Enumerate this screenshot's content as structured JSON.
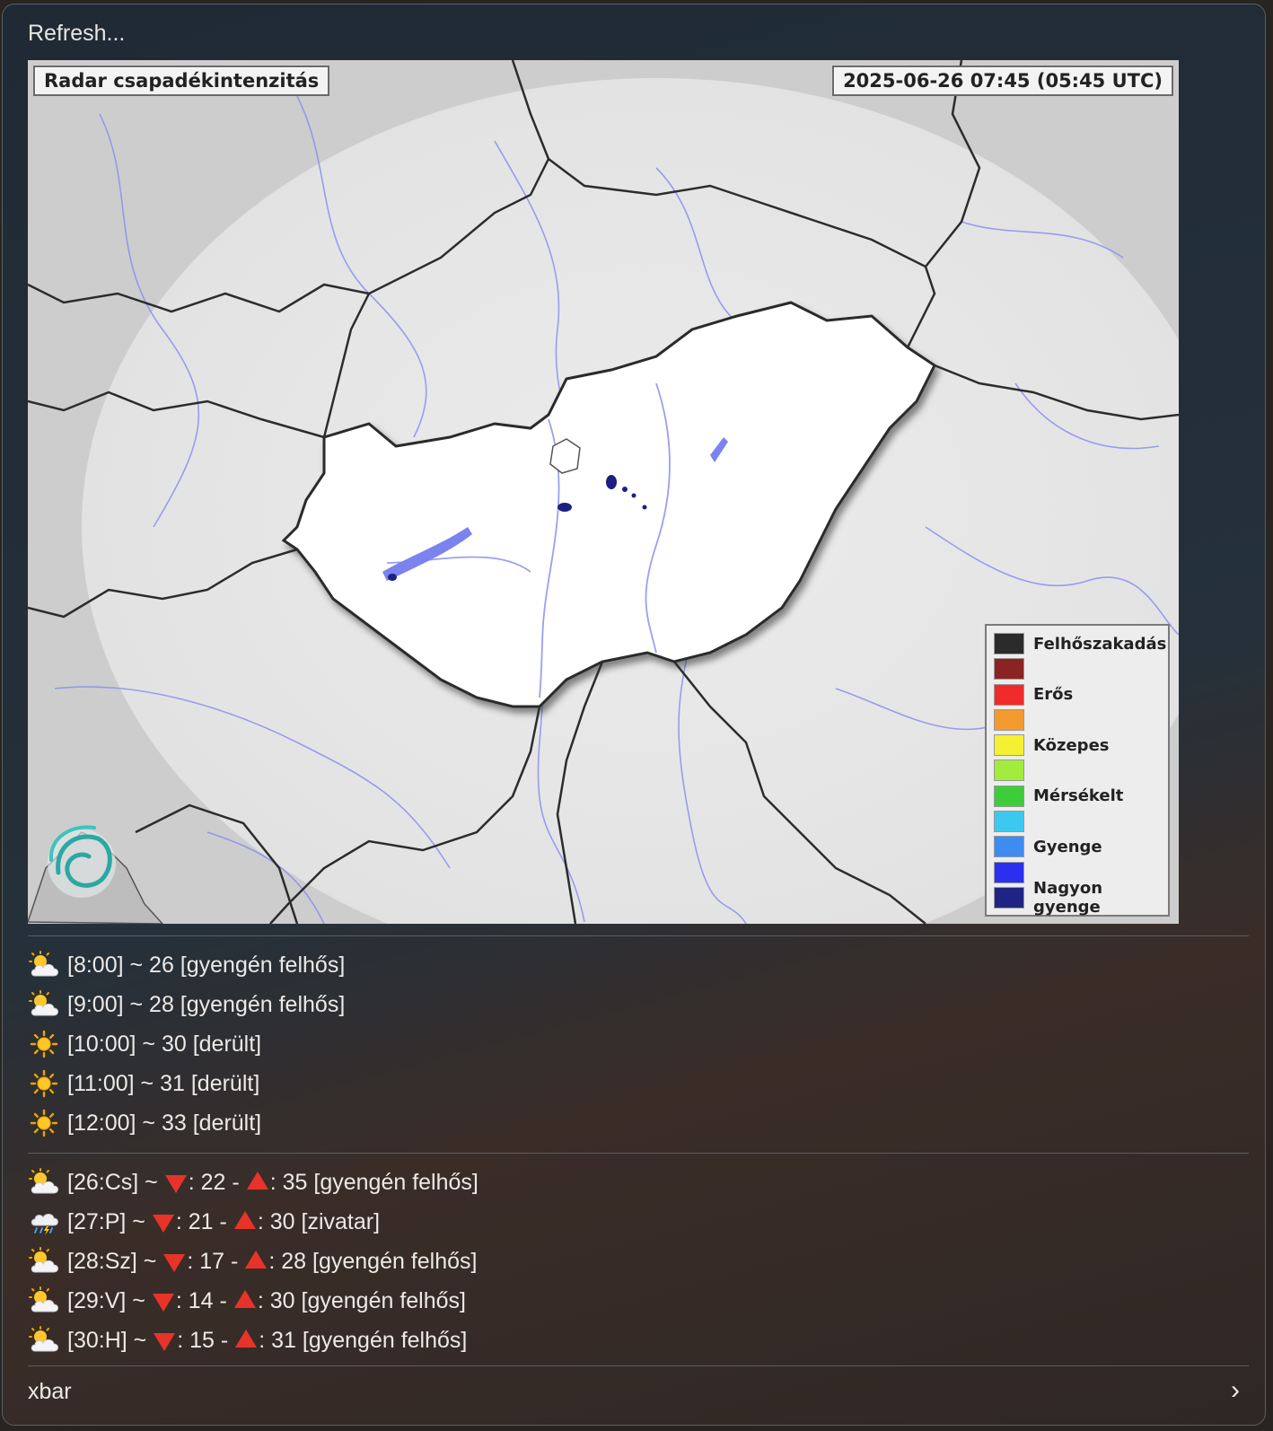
{
  "menu": {
    "refresh_label": "Refresh...",
    "footer_label": "xbar",
    "submenu_arrow": "›"
  },
  "radar": {
    "title": "Radar csapadékintenzitás",
    "timestamp": "2025-06-26 07:45 (05:45 UTC)",
    "legend": [
      {
        "label": "Felhőszakadás",
        "color": "#2b2b2b"
      },
      {
        "label": "",
        "color": "#8c2323"
      },
      {
        "label": "Erős",
        "color": "#f02b2b"
      },
      {
        "label": "",
        "color": "#f39a2f"
      },
      {
        "label": "Közepes",
        "color": "#f5f032"
      },
      {
        "label": "",
        "color": "#a2ec3c"
      },
      {
        "label": "Mérsékelt",
        "color": "#3fcc3a"
      },
      {
        "label": "",
        "color": "#3dc8f0"
      },
      {
        "label": "Gyenge",
        "color": "#3d8cf2"
      },
      {
        "label": "",
        "color": "#2b2ff0"
      },
      {
        "label": "Nagyon gyenge",
        "color": "#1f2484"
      }
    ]
  },
  "hourly": [
    {
      "icon": "sun-behind-cloud-icon",
      "text": "[8:00] ~ 26 [gyengén felhős]"
    },
    {
      "icon": "sun-behind-cloud-icon",
      "text": "[9:00] ~ 28 [gyengén felhős]"
    },
    {
      "icon": "sun-icon",
      "text": "[10:00] ~ 30 [derült]"
    },
    {
      "icon": "sun-icon",
      "text": "[11:00] ~ 31 [derült]"
    },
    {
      "icon": "sun-icon",
      "text": "[12:00] ~ 33 [derült]"
    }
  ],
  "daily": [
    {
      "icon": "sun-behind-cloud-icon",
      "day": "[26:Cs] ~",
      "min": ": 22 -",
      "max": ": 35 [gyengén felhős]"
    },
    {
      "icon": "thunder-rain-cloud-icon",
      "day": "[27:P] ~",
      "min": ": 21 -",
      "max": ": 30 [zivatar]"
    },
    {
      "icon": "sun-behind-cloud-icon",
      "day": "[28:Sz] ~",
      "min": ": 17 -",
      "max": ": 28 [gyengén felhős]"
    },
    {
      "icon": "sun-behind-cloud-icon",
      "day": "[29:V] ~",
      "min": ": 14 -",
      "max": ": 30 [gyengén felhős]"
    },
    {
      "icon": "sun-behind-cloud-icon",
      "day": "[30:H] ~",
      "min": ": 15 -",
      "max": ": 31 [gyengén felhős]"
    }
  ]
}
